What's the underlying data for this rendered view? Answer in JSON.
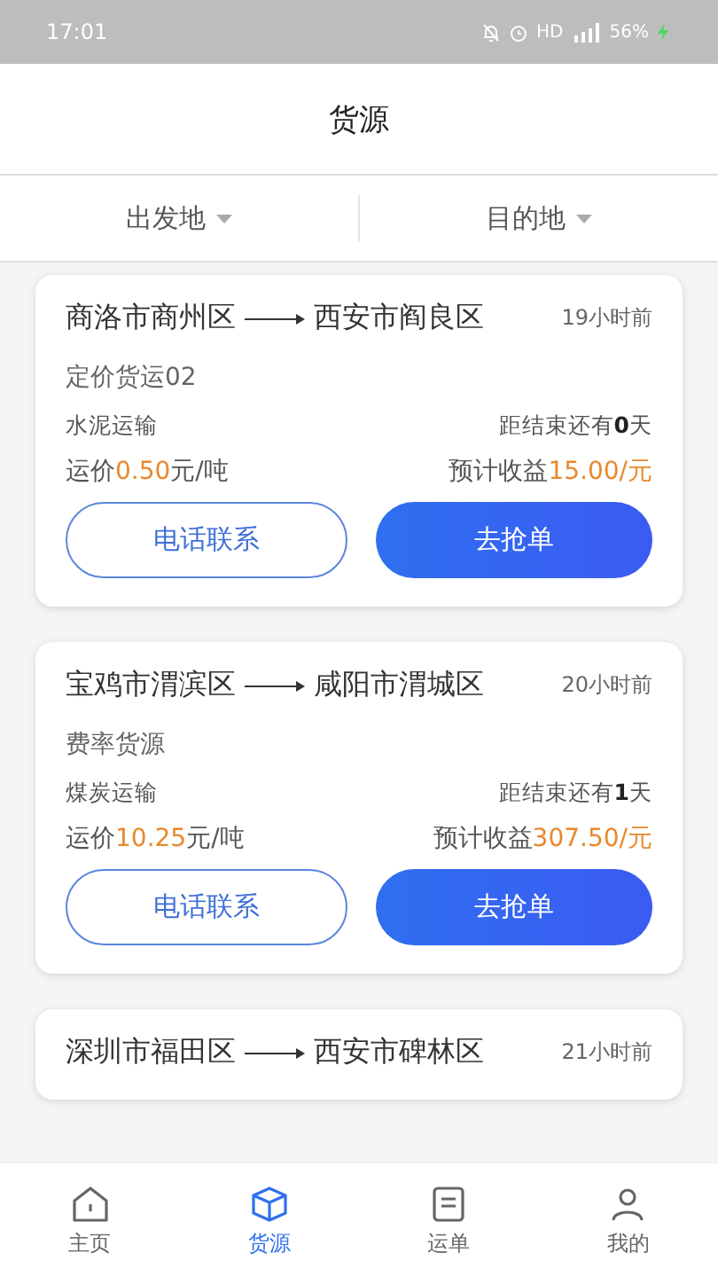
{
  "status_bar": {
    "time": "17:01",
    "network": "HD",
    "battery": "56%"
  },
  "header": {
    "title": "货源"
  },
  "filters": [
    {
      "label": "出发地"
    },
    {
      "label": "目的地"
    }
  ],
  "cards": [
    {
      "from": "商洛市商州区",
      "to": "西安市阎良区",
      "time": "19小时前",
      "title": "定价货运02",
      "cargo": "水泥运输",
      "remaining": "距结束还有**0**天",
      "price_label": "运价",
      "price_value": "0.50",
      "price_unit": "元/吨",
      "income_label": "预计收益",
      "income_value": "15.00/元",
      "call_button": "电话联系",
      "grab_button": "去抢单"
    },
    {
      "from": "宝鸡市渭滨区",
      "to": "咸阳市渭城区",
      "time": "20小时前",
      "title": "费率货源",
      "cargo": "煤炭运输",
      "remaining": "距结束还有**1**天",
      "price_label": "运价",
      "price_value": "10.25",
      "price_unit": "元/吨",
      "income_label": "预计收益",
      "income_value": "307.50/元",
      "call_button": "电话联系",
      "grab_button": "去抢单"
    },
    {
      "from": "深圳市福田区",
      "to": "西安市碑林区",
      "time": "21小时前"
    }
  ],
  "tab_bar": [
    {
      "label": "主页",
      "selected": false
    },
    {
      "label": "货源",
      "selected": true
    },
    {
      "label": "运单",
      "selected": false
    },
    {
      "label": "我的",
      "selected": false
    }
  ]
}
